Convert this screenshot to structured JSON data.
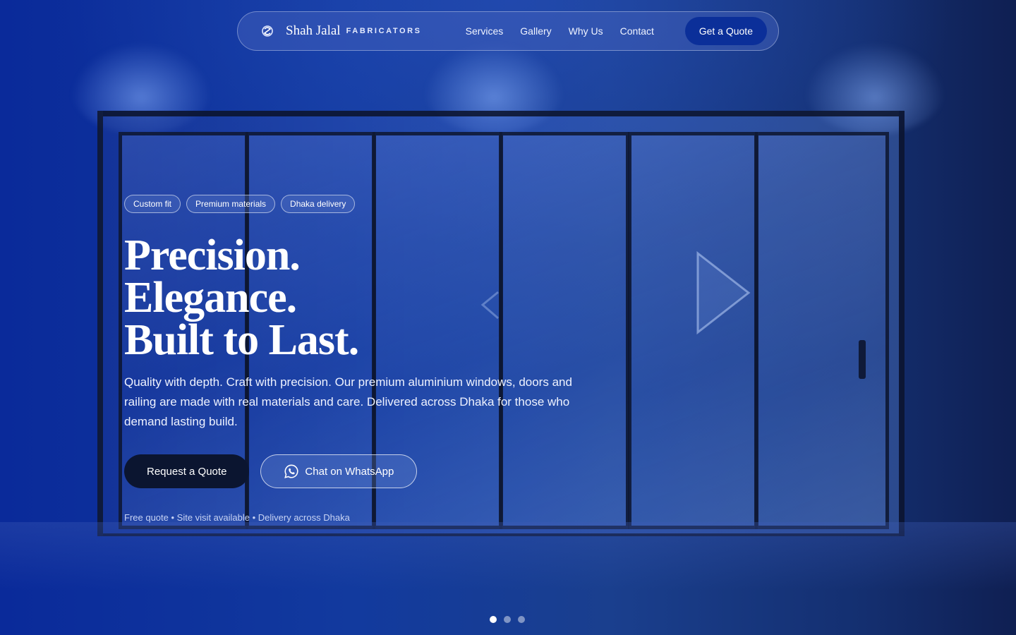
{
  "brand": {
    "name": "Shah Jalal",
    "sub": "FABRICATORS"
  },
  "nav": {
    "links": [
      "Services",
      "Gallery",
      "Why Us",
      "Contact"
    ],
    "cta": "Get a Quote"
  },
  "hero": {
    "chips": [
      "Custom fit",
      "Premium materials",
      "Dhaka delivery"
    ],
    "headline": [
      "Precision.",
      "Elegance.",
      "Built to Last."
    ],
    "lead": "Quality with depth. Craft with precision. Our premium aluminium windows, doors and railing are made with real materials and care. Delivered across Dhaka for those who demand lasting build.",
    "primary_cta": "Request a Quote",
    "secondary_cta": "Chat on WhatsApp",
    "note": "Free quote • Site visit available • Delivery across Dhaka"
  },
  "carousel": {
    "slide_count": 3,
    "active_index": 0
  },
  "colors": {
    "accent": "#0b2f99",
    "dark_button": "#0b1530"
  },
  "icons": [
    "brand-logo-icon",
    "whatsapp-icon",
    "play-arrow-icon",
    "prev-arrow-icon"
  ]
}
